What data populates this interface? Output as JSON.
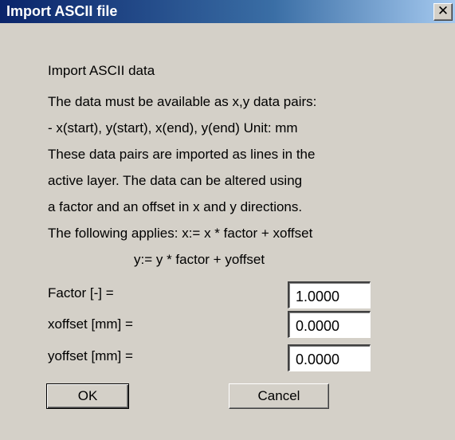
{
  "window": {
    "title": "Import ASCII file",
    "close_glyph": "✕"
  },
  "body": {
    "heading": "Import ASCII data",
    "lines": [
      "The data must be available as x,y data pairs:",
      " - x(start), y(start), x(end), y(end) Unit: mm",
      "These data pairs are imported as lines in the",
      "active layer. The data can be altered using",
      "a factor and an offset in x and y directions.",
      "The following applies:  x:= x * factor + xoffset",
      "y:= y * factor + yoffset"
    ]
  },
  "fields": {
    "factor": {
      "label": "Factor   [-] =",
      "value": "1.0000"
    },
    "xoffset": {
      "label": "xoffset [mm] =",
      "value": "0.0000"
    },
    "yoffset": {
      "label": "yoffset [mm] =",
      "value": "0.0000"
    }
  },
  "buttons": {
    "ok_label": "OK",
    "cancel_label": "Cancel"
  }
}
